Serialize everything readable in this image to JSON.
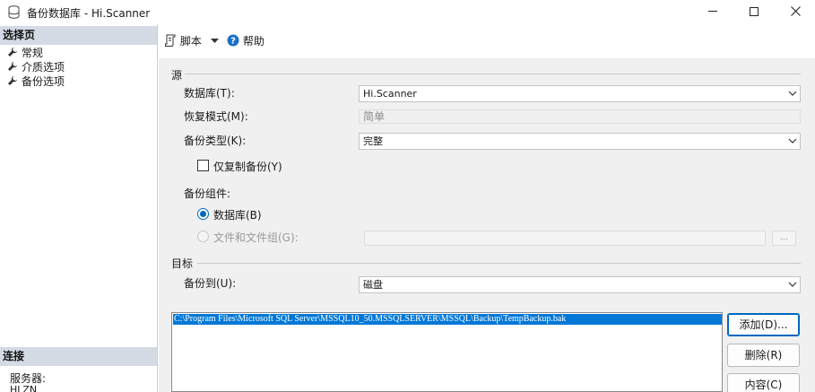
{
  "window": {
    "title": "备份数据库 - Hi.Scanner",
    "icon": "database-icon"
  },
  "sidebar": {
    "header": "选择页",
    "items": [
      {
        "label": "常规",
        "icon": "wrench-icon"
      },
      {
        "label": "介质选项",
        "icon": "wrench-icon"
      },
      {
        "label": "备份选项",
        "icon": "wrench-icon"
      }
    ],
    "connection": {
      "header": "连接",
      "server_label": "服务器:",
      "server_value": "HLZN"
    }
  },
  "toolbar": {
    "script_label": "脚本",
    "help_label": "帮助"
  },
  "source": {
    "group_label": "源",
    "database_label": "数据库(T):",
    "database_value": "Hi.Scanner",
    "recovery_label": "恢复模式(M):",
    "recovery_value": "简单",
    "backup_type_label": "备份类型(K):",
    "backup_type_value": "完整",
    "copy_only_label": "仅复制备份(Y)",
    "copy_only_checked": false,
    "component_label": "备份组件:",
    "component_database_label": "数据库(B)",
    "component_files_label": "文件和文件组(G):",
    "files_button_label": "..."
  },
  "destination": {
    "group_label": "目标",
    "backup_to_label": "备份到(U):",
    "backup_to_value": "磁盘",
    "paths": [
      "C:\\Program Files\\Microsoft SQL Server\\MSSQL10_50.MSSQLSERVER\\MSSQL\\Backup\\TempBackup.bak"
    ],
    "add_label": "添加(D)...",
    "remove_label": "删除(R)",
    "contents_label": "内容(C)"
  },
  "colors": {
    "accent": "#0067c0",
    "selection": "#0078d7",
    "section_header": "#d4dbe5",
    "panel_bg": "#f0f0f0"
  }
}
